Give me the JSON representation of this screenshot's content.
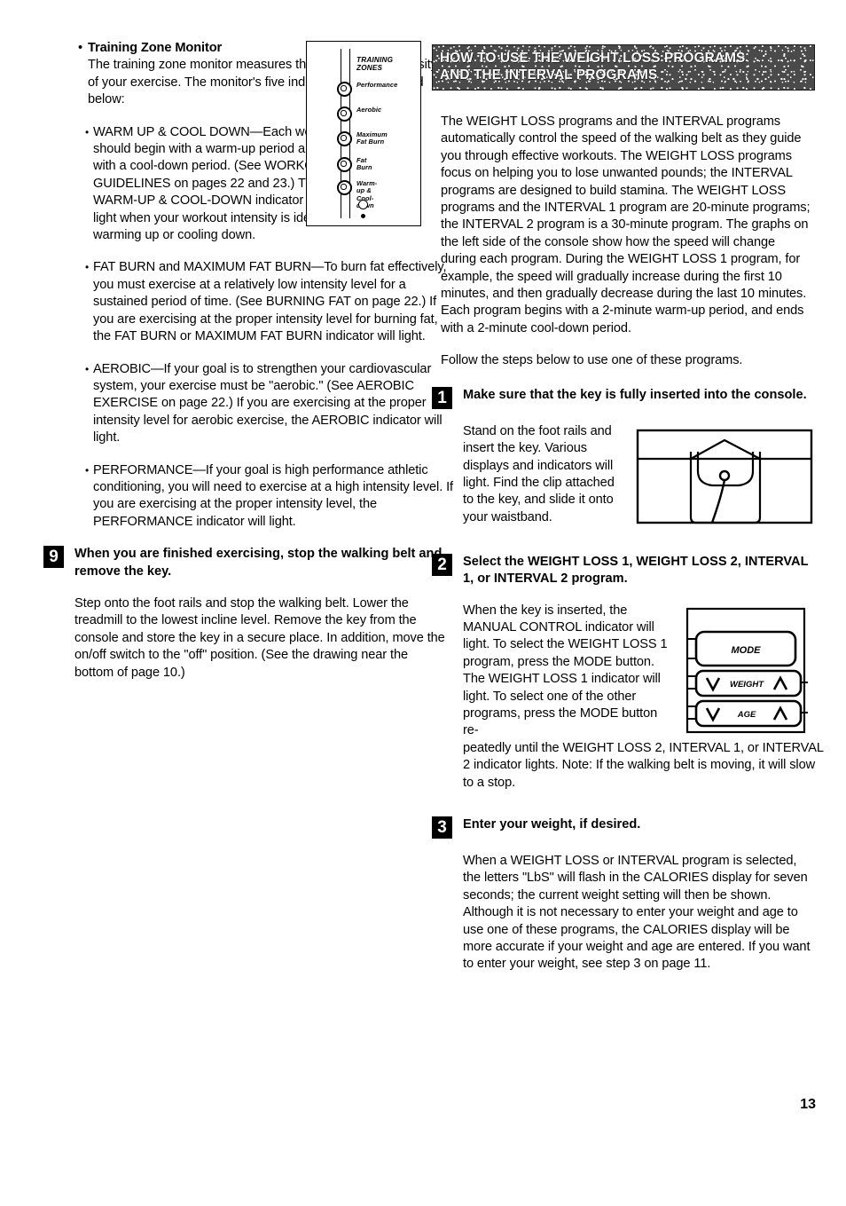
{
  "page": {
    "number": "13"
  },
  "left_column": {
    "heading": "Training Zone Monitor",
    "intro": "The training zone monitor measures the approximate intensity of your exercise. The monitor's five indicators are described below:",
    "bullets": [
      {
        "name": "warm-up-cool-down",
        "text": "WARM UP & COOL DOWN—Each workout should begin with a warm-up period and end with a cool-down period. (See WORKOUT GUIDELINES on pages 22 and 23.) The WARM-UP & COOL-DOWN indicator will light when your workout intensity is ideal for warming up or cooling down."
      },
      {
        "name": "fat-burn",
        "text": "FAT BURN and MAXIMUM FAT BURN—To burn fat effectively, you must exercise at a relatively low intensity level for a sustained period of time. (See BURNING FAT on page 22.) If you are exercising at the proper intensity level for burning fat, the FAT BURN or MAXIMUM FAT BURN indicator will light."
      },
      {
        "name": "aerobic",
        "text": "AEROBIC—If your goal is to strengthen your cardiovascular system, your exercise must be \"aerobic.\" (See AEROBIC EXERCISE on page 22.) If you are exercising at the proper intensity level for aerobic exercise, the AEROBIC indicator will light."
      },
      {
        "name": "performance",
        "text": "PERFORMANCE—If your goal is high performance athletic conditioning, you will need to exercise at a high intensity level. If you are exercising at the proper intensity level, the PERFORMANCE indicator will light."
      }
    ],
    "step9": {
      "number": "9",
      "title": "When you are finished exercising, stop the walking belt and remove the key.",
      "body": "Step onto the foot rails and stop the walking belt. Lower the treadmill to the lowest incline level. Remove the key from the console and store the key in a secure place. In addition, move the on/off switch to the \"off\" position. (See the drawing near the bottom of page 10.)"
    }
  },
  "training_zone_figure": {
    "title": "TRAINING\nZONES",
    "indicators": [
      "Performance",
      "Aerobic",
      "Maximum\nFat Burn",
      "Fat Burn",
      "Warm-up &\nCool-down"
    ]
  },
  "right_column": {
    "banner_title": "HOW TO USE THE WEIGHT LOSS PROGRAMS\nAND THE INTERVAL PROGRAMS",
    "intro_paragraph": "The WEIGHT LOSS programs and the INTERVAL programs automatically control the speed of the walking belt as they guide you through effective workouts. The WEIGHT LOSS programs focus on helping you to lose unwanted pounds; the INTERVAL programs are designed to build stamina. The WEIGHT LOSS programs and the INTERVAL 1 program are 20-minute programs; the INTERVAL 2 program is a 30-minute program. The graphs on the left side of the console show how the speed will change during each program. During the WEIGHT LOSS 1 program, for example, the speed will gradually increase during the first 10 minutes, and then gradually decrease during the last 10 minutes. Each program begins with a 2-minute warm-up period, and ends with a 2-minute cool-down period.",
    "follow_line": "Follow the steps below to use one of these programs.",
    "steps": [
      {
        "number": "1",
        "title": "Make sure that the key is fully inserted into the console.",
        "body": "Stand on the foot rails and insert the key. Various displays and indicators will light. Find the clip attached to the key, and slide it onto your waistband."
      },
      {
        "number": "2",
        "title": "Select the WEIGHT LOSS 1, WEIGHT LOSS 2, INTERVAL 1, or INTERVAL 2 program.",
        "body_top": "When the key is inserted, the MANUAL CONTROL indicator will light. To select the WEIGHT LOSS 1 program, press the MODE button. The WEIGHT LOSS 1 indicator will light. To select one of the other programs, press the MODE button re-",
        "body_bottom": "peatedly until the WEIGHT LOSS 2, INTERVAL 1, or INTERVAL 2 indicator lights. Note: If the walking belt is moving, it will slow to a stop."
      },
      {
        "number": "3",
        "title": "Enter your weight, if desired.",
        "body": "When a WEIGHT LOSS or INTERVAL program is selected, the letters \"LbS\" will flash in the CALORIES display for seven seconds; the current weight setting will then be shown. Although it is not necessary to enter your weight and age to use one of these programs, the CALORIES display will be more accurate if your weight and age are entered. If you want to enter your weight, see step 3 on page 11."
      }
    ],
    "console_figure": {
      "mode_label": "MODE",
      "weight_label": "WEIGHT",
      "age_label": "AGE"
    }
  }
}
